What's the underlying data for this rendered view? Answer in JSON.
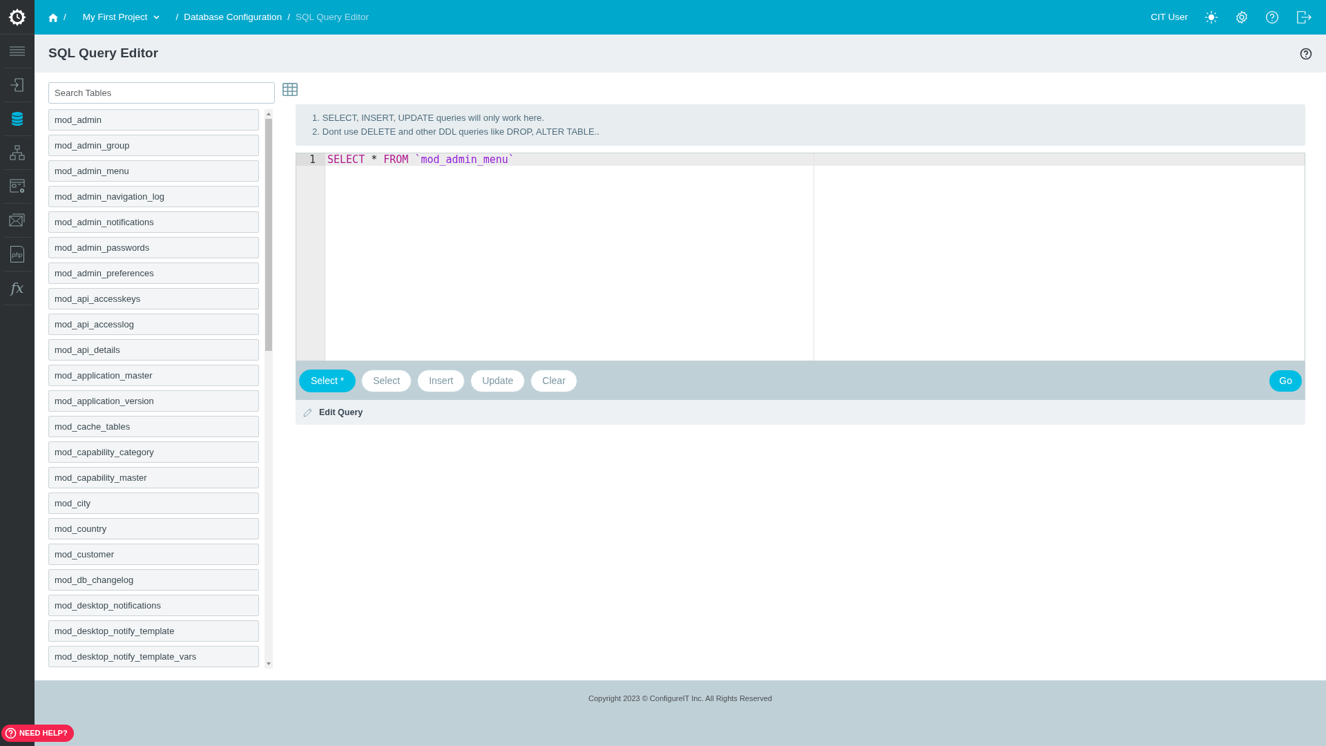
{
  "sidebar": {
    "items": [
      {
        "kind": "menu",
        "selected": false
      },
      {
        "kind": "login",
        "selected": false
      },
      {
        "kind": "database",
        "selected": true
      },
      {
        "kind": "hierarchy",
        "selected": false
      },
      {
        "kind": "window-settings",
        "selected": false
      },
      {
        "kind": "mail",
        "selected": false
      },
      {
        "kind": "php",
        "selected": false,
        "glyph": "php"
      },
      {
        "kind": "function",
        "selected": false,
        "glyph": "fx"
      }
    ]
  },
  "topbar": {
    "breadcrumbs": [
      {
        "kind": "home"
      },
      {
        "kind": "separator",
        "label": "/"
      },
      {
        "kind": "dropdown",
        "label": "My First Project"
      },
      {
        "kind": "separator",
        "label": "/"
      },
      {
        "kind": "link",
        "label": "Database Configuration"
      },
      {
        "kind": "separator",
        "label": "/"
      },
      {
        "kind": "current",
        "label": "SQL Query Editor"
      }
    ],
    "user": "CIT User"
  },
  "page": {
    "title": "SQL Query Editor"
  },
  "search": {
    "placeholder": "Search Tables"
  },
  "tables": [
    "mod_admin",
    "mod_admin_group",
    "mod_admin_menu",
    "mod_admin_navigation_log",
    "mod_admin_notifications",
    "mod_admin_passwords",
    "mod_admin_preferences",
    "mod_api_accesskeys",
    "mod_api_accesslog",
    "mod_api_details",
    "mod_application_master",
    "mod_application_version",
    "mod_cache_tables",
    "mod_capability_category",
    "mod_capability_master",
    "mod_city",
    "mod_country",
    "mod_customer",
    "mod_db_changelog",
    "mod_desktop_notifications",
    "mod_desktop_notify_template",
    "mod_desktop_notify_template_vars"
  ],
  "notes": [
    {
      "marker": "1.",
      "text": "SELECT, INSERT, UPDATE queries will only work here."
    },
    {
      "marker": "2.",
      "text": "Dont use DELETE and other DDL queries like DROP, ALTER TABLE.."
    }
  ],
  "editor": {
    "lines": [
      {
        "number": "1",
        "tokens": [
          {
            "kind": "keyword",
            "text": "SELECT"
          },
          {
            "kind": "plain",
            "text": " * "
          },
          {
            "kind": "keyword",
            "text": "FROM"
          },
          {
            "kind": "identifier",
            "text": " `mod_admin_menu`"
          }
        ]
      }
    ]
  },
  "buttons": [
    {
      "label": "Select *",
      "selected": true
    },
    {
      "label": "Select",
      "selected": false
    },
    {
      "label": "Insert",
      "selected": false
    },
    {
      "label": "Update",
      "selected": false
    },
    {
      "label": "Clear",
      "selected": false
    }
  ],
  "go_button": "Go",
  "edit_query": "Edit Query",
  "footer": "Copyright 2023 © ConfigureIT Inc. All Rights Reserved",
  "help_button": "NEED HELP?"
}
